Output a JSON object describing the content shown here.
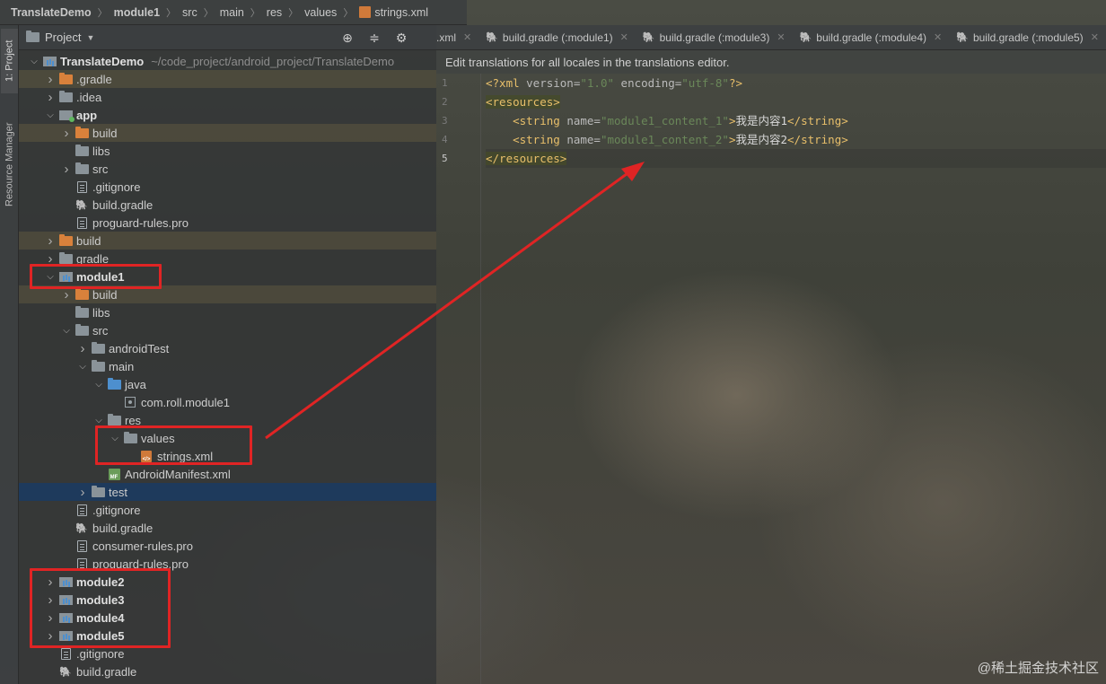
{
  "breadcrumb": [
    "TranslateDemo",
    "module1",
    "src",
    "main",
    "res",
    "values",
    "strings.xml"
  ],
  "tool_strip": {
    "project_tab": "1: Project",
    "resource_tab": "Resource Manager"
  },
  "project_panel": {
    "title": "Project"
  },
  "tree": [
    {
      "label": "TranslateDemo",
      "path": "~/code_project/android_project/TranslateDemo",
      "bold": true,
      "depth": 0,
      "arrow": "down",
      "icon": "module-folder-icon"
    },
    {
      "label": ".gradle",
      "depth": 1,
      "arrow": "right",
      "icon": "folder-orange-icon",
      "hl": true
    },
    {
      "label": ".idea",
      "depth": 1,
      "arrow": "right",
      "icon": "folder-icon"
    },
    {
      "label": "app",
      "depth": 1,
      "arrow": "down",
      "icon": "app-module-icon",
      "bold": true
    },
    {
      "label": "build",
      "depth": 2,
      "arrow": "right",
      "icon": "folder-orange-icon",
      "hl": true
    },
    {
      "label": "libs",
      "depth": 2,
      "arrow": "",
      "icon": "folder-icon"
    },
    {
      "label": "src",
      "depth": 2,
      "arrow": "right",
      "icon": "folder-icon"
    },
    {
      "label": ".gitignore",
      "depth": 2,
      "arrow": "",
      "icon": "file-icon"
    },
    {
      "label": "build.gradle",
      "depth": 2,
      "arrow": "",
      "icon": "gradle-icon"
    },
    {
      "label": "proguard-rules.pro",
      "depth": 2,
      "arrow": "",
      "icon": "file-icon"
    },
    {
      "label": "build",
      "depth": 1,
      "arrow": "right",
      "icon": "folder-orange-icon",
      "hl": true
    },
    {
      "label": "gradle",
      "depth": 1,
      "arrow": "right",
      "icon": "folder-icon"
    },
    {
      "label": "module1",
      "depth": 1,
      "arrow": "down",
      "icon": "module-folder-icon",
      "bold": true
    },
    {
      "label": "build",
      "depth": 2,
      "arrow": "right",
      "icon": "folder-orange-icon",
      "hl": true
    },
    {
      "label": "libs",
      "depth": 2,
      "arrow": "",
      "icon": "folder-icon"
    },
    {
      "label": "src",
      "depth": 2,
      "arrow": "down",
      "icon": "folder-icon"
    },
    {
      "label": "androidTest",
      "depth": 3,
      "arrow": "right",
      "icon": "folder-icon"
    },
    {
      "label": "main",
      "depth": 3,
      "arrow": "down",
      "icon": "folder-icon"
    },
    {
      "label": "java",
      "depth": 4,
      "arrow": "down",
      "icon": "folder-blue-icon"
    },
    {
      "label": "com.roll.module1",
      "depth": 5,
      "arrow": "",
      "icon": "package-icon"
    },
    {
      "label": "res",
      "depth": 4,
      "arrow": "down",
      "icon": "folder-res-icon"
    },
    {
      "label": "values",
      "depth": 5,
      "arrow": "down",
      "icon": "folder-icon"
    },
    {
      "label": "strings.xml",
      "depth": 6,
      "arrow": "",
      "icon": "xml-file-icon"
    },
    {
      "label": "AndroidManifest.xml",
      "depth": 4,
      "arrow": "",
      "icon": "manifest-icon"
    },
    {
      "label": "test",
      "depth": 3,
      "arrow": "right",
      "icon": "folder-icon",
      "sel": true
    },
    {
      "label": ".gitignore",
      "depth": 2,
      "arrow": "",
      "icon": "file-icon"
    },
    {
      "label": "build.gradle",
      "depth": 2,
      "arrow": "",
      "icon": "gradle-icon"
    },
    {
      "label": "consumer-rules.pro",
      "depth": 2,
      "arrow": "",
      "icon": "file-icon"
    },
    {
      "label": "proguard-rules.pro",
      "depth": 2,
      "arrow": "",
      "icon": "file-icon"
    },
    {
      "label": "module2",
      "depth": 1,
      "arrow": "right",
      "icon": "module-folder-icon",
      "bold": true
    },
    {
      "label": "module3",
      "depth": 1,
      "arrow": "right",
      "icon": "module-folder-icon",
      "bold": true
    },
    {
      "label": "module4",
      "depth": 1,
      "arrow": "right",
      "icon": "module-folder-icon",
      "bold": true
    },
    {
      "label": "module5",
      "depth": 1,
      "arrow": "right",
      "icon": "module-folder-icon",
      "bold": true
    },
    {
      "label": ".gitignore",
      "depth": 1,
      "arrow": "",
      "icon": "file-icon"
    },
    {
      "label": "build.gradle",
      "depth": 1,
      "arrow": "",
      "icon": "gradle-icon"
    }
  ],
  "editor_tabs": [
    {
      "label": ".xml",
      "icon": "xml-file-icon"
    },
    {
      "label": "build.gradle (:module1)",
      "icon": "gradle-icon"
    },
    {
      "label": "build.gradle (:module3)",
      "icon": "gradle-icon"
    },
    {
      "label": "build.gradle (:module4)",
      "icon": "gradle-icon"
    },
    {
      "label": "build.gradle (:module5)",
      "icon": "gradle-icon"
    }
  ],
  "banner": "Edit translations for all locales in the translations editor.",
  "line_numbers": [
    "1",
    "2",
    "3",
    "4",
    "5"
  ],
  "code": {
    "l1_open": "<?xml ",
    "l1_attr1": "version=",
    "l1_val1": "\"1.0\"",
    "l1_attr2": " encoding=",
    "l1_val2": "\"utf-8\"",
    "l1_close": "?>",
    "l2": "<resources>",
    "l3_tag": "<string ",
    "l3_attr": "name=",
    "l3_val": "\"module1_content_1\"",
    "l3_gt": ">",
    "l3_text": "我是内容1",
    "l3_end": "</string>",
    "l4_tag": "<string ",
    "l4_attr": "name=",
    "l4_val": "\"module1_content_2\"",
    "l4_gt": ">",
    "l4_text": "我是内容2",
    "l4_end": "</string>",
    "l5": "</resources>"
  },
  "watermark": "@稀土掘金技术社区",
  "colors": {
    "annotation_red": "#e02424",
    "xml_tag": "#e8bf6a",
    "xml_value": "#6a8759"
  }
}
